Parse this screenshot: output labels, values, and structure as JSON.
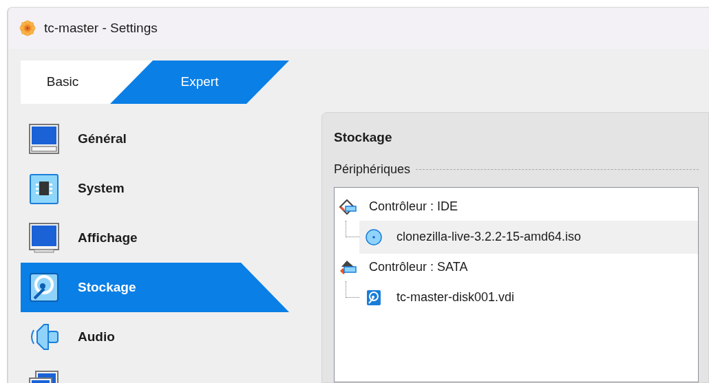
{
  "window": {
    "title": "tc-master - Settings"
  },
  "tabs": [
    {
      "label": "Basic",
      "selected": false
    },
    {
      "label": "Expert",
      "selected": true
    }
  ],
  "sidebar": {
    "items": [
      {
        "label": "Général",
        "kind": "general",
        "selected": false
      },
      {
        "label": "System",
        "kind": "system",
        "selected": false
      },
      {
        "label": "Affichage",
        "kind": "display",
        "selected": false
      },
      {
        "label": "Stockage",
        "kind": "storage",
        "selected": true
      },
      {
        "label": "Audio",
        "kind": "audio",
        "selected": false
      },
      {
        "kind": "network",
        "selected": false
      }
    ]
  },
  "panel": {
    "title": "Stockage",
    "group_label": "Périphériques",
    "tree": [
      {
        "label": "Contrôleur : IDE",
        "kind": "ide",
        "children": [
          {
            "label": "clonezilla-live-3.2.2-15-amd64.iso",
            "kind": "optical",
            "selected": true
          }
        ]
      },
      {
        "label": "Contrôleur : SATA",
        "kind": "sata",
        "children": [
          {
            "label": "tc-master-disk001.vdi",
            "kind": "disk",
            "selected": false
          }
        ]
      }
    ]
  }
}
